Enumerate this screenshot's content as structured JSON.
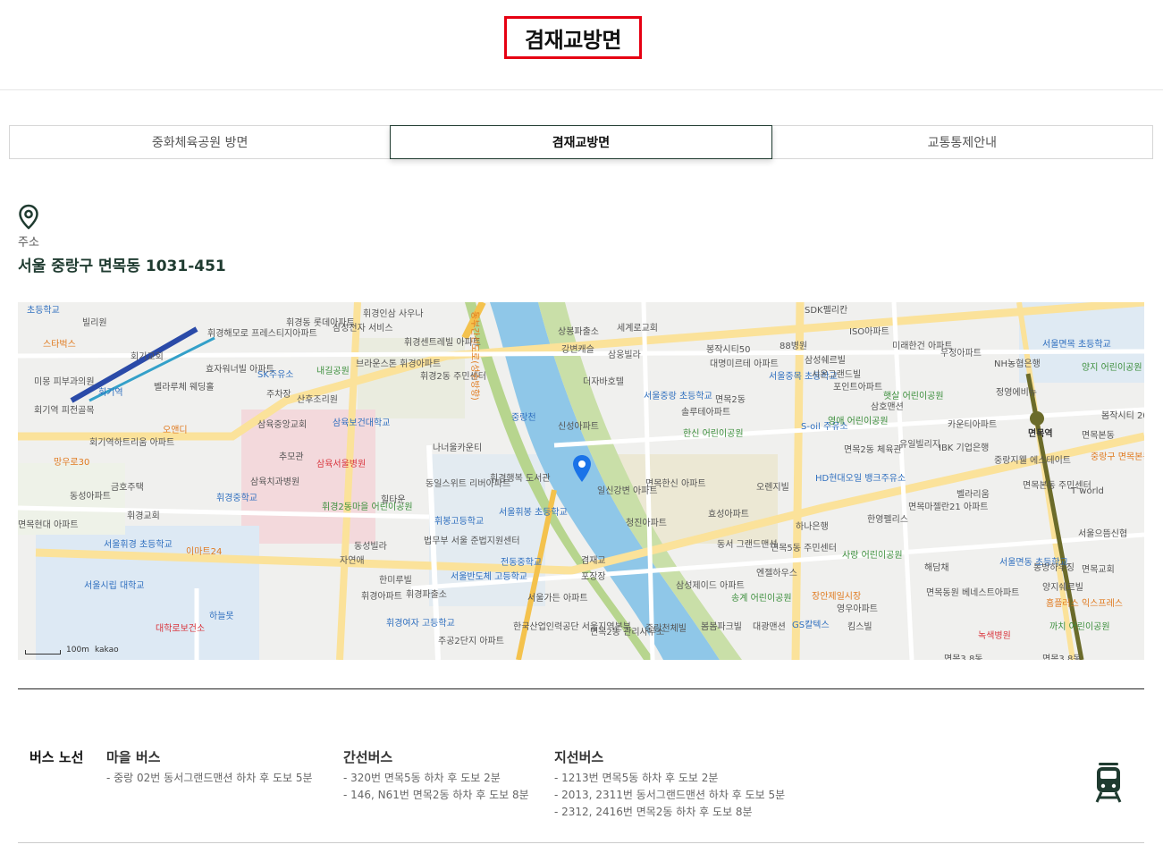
{
  "page": {
    "title": "겸재교방면"
  },
  "tabs": [
    {
      "label": "중화체육공원 방면",
      "active": false
    },
    {
      "label": "겸재교방면",
      "active": true
    },
    {
      "label": "교통통제안내",
      "active": false
    }
  ],
  "address": {
    "icon": "map-pin-icon",
    "label": "주소",
    "value": "서울 중랑구 면목동 1031-451"
  },
  "map": {
    "scale_label": "100m",
    "brand": "kakao",
    "labels": {
      "l1": "초등학교",
      "l2": "빌리원",
      "l3": "스타벅스",
      "l4": "회기역",
      "l5": "회기교회",
      "l6": "휘경해모로 프레스티지아파트",
      "l7": "휘경동 롯데아파트",
      "l8": "삼성전자 서비스",
      "l9": "휘경센트레빌 아파트",
      "l10": "휘경2동 주민센터",
      "l11": "SK주유소",
      "l12": "내길공원",
      "l13": "브라운스톤 휘경아파트",
      "l14": "산후조리원",
      "l15": "삼육중앙교회",
      "l16": "삼육보건대학교",
      "l17": "삼육서울병원",
      "l18": "나너울카운티",
      "l19": "동일스위트 리버아파트",
      "l20": "휘경행복 도서관",
      "l21": "휘봉고등학교",
      "l22": "서울휘봉 초등학교",
      "l23": "휘경2동마을 어린이공원",
      "l24": "법무부 서울 준법지원센터",
      "l25": "전동중학교",
      "l26": "서울반도체 고등학교",
      "l27": "휘경여자 고등학교",
      "l28": "주공2단지 아파트",
      "l29": "서울가든 아파트",
      "l30": "한국산업인력공단 서울지역본부",
      "l31": "상봉파출소",
      "l32": "세계로교회",
      "l33": "강변캐슬",
      "l34": "삼웅빌라",
      "l35": "더자바호텔",
      "l36": "신성아파트",
      "l37": "일신강변 아파트",
      "l38": "면목한신 아파트",
      "l39": "청진아파트",
      "l40": "한신 어린이공원",
      "l41": "서울중랑 초등학교",
      "l42": "솔루테아파트",
      "l43": "봉작시티50",
      "l44": "대명미르테 아파트",
      "l45": "서울중목 초등학교",
      "l46": "면목2동",
      "l47": "88병원",
      "l48": "삼성쉐르빌",
      "l49": "시온그랜드빌",
      "l50": "포인트아파트",
      "l51": "S-oil 주유소",
      "l52": "영애 어린이공원",
      "l53": "면목2동 체육관",
      "l54": "HD현대오일 뱅크주유소",
      "l55": "오렌지빌",
      "l56": "효성아파트",
      "l57": "하나은행",
      "l58": "동서 그랜드맨션",
      "l59": "면목5동 주민센터",
      "l60": "엔젤하우스",
      "l61": "삼성제이드 아파트",
      "l62": "송계 어린이공원",
      "l63": "장안제일시장",
      "l64": "GS칼텍스",
      "l65": "SDK펠리칸",
      "l66": "ISO아파트",
      "l67": "미래한건 아파트",
      "l68": "우정아파트",
      "l69": "NH농협은행",
      "l70": "서울면목 초등학교",
      "l71": "양지 어린이공원",
      "l72": "정영에비뉴",
      "l73": "면목역",
      "l74": "봄작시티 201",
      "l75": "면목본동",
      "l76": "IBK 기업은행",
      "l77": "중랑지웰 에스테이트",
      "l78": "면목본동 주민센터",
      "l79": "T world",
      "l80": "면목마젤란21 아파트",
      "l81": "벨라리움",
      "l82": "서울으뜸신협",
      "l83": "서울면동 초등학교",
      "l84": "동방하우징",
      "l85": "면목교회",
      "l86": "양지쉐르빌",
      "l87": "홈플러스 익스프레스",
      "l88": "녹색병원",
      "l89": "까치 어린이공원",
      "l90": "면목3.8동",
      "l91": "면목동원 베네스트아파트",
      "l92": "사랑 어린이공원",
      "l93": "한영펠리스",
      "l94": "해담채",
      "l95": "영우아파트",
      "l96": "킴스빌",
      "l97": "대광맨션",
      "l98": "봄봄파크빌",
      "l99": "중랑천체빌",
      "l100": "이마트24",
      "l101": "서울휘경 초등학교",
      "l102": "서울시립 대학교",
      "l103": "대학로보건소",
      "l104": "하늘못",
      "l105": "중랑천",
      "l106": "겸재교",
      "l107": "포장장",
      "l108": "휘경교회",
      "l109": "동성빌라",
      "l110": "자연애",
      "l111": "한미루빌",
      "l112": "휘경아파트",
      "l113": "휘경파출소",
      "l114": "힐타운",
      "l115": "삼육치과병원",
      "l116": "휘경중학교",
      "l117": "금호주택",
      "l118": "동성아파트",
      "l119": "오앤디",
      "l120": "망우로30",
      "l121": "회기역하트리움 아파트",
      "l122": "벨라루체 웨딩홀",
      "l123": "효자워너빌 아파트",
      "l124": "미몽 피부과의원",
      "l125": "회기역 피전골목",
      "l126": "추모관",
      "l127": "주차장",
      "l128": "동부간선도로(성수방향)",
      "l129": "유일빌리지",
      "l130": "면목2동 관리사무소",
      "l131": "면목현대 아파트",
      "l132": "카운티아파트",
      "l133": "중랑구 면목본동 공공지원민간",
      "l134": "휘경인삼 사우나",
      "l135": "삼호맨션",
      "l136": "면목3.8동",
      "l137": "햇살 어린이공원"
    }
  },
  "bus": {
    "title": "버스 노선",
    "groups": [
      {
        "name": "마을 버스",
        "items": [
          "- 중랑 02번 동서그랜드맨션 하차 후 도보 5분"
        ]
      },
      {
        "name": "간선버스",
        "items": [
          "- 320번 면목5동 하차 후 도보 2분",
          "- 146, N61번 면목2동 하차 후 도보 8분"
        ]
      },
      {
        "name": "지선버스",
        "items": [
          "- 1213번 면목5동 하차 후 도보 2분",
          "- 2013, 2311번 동서그랜드맨션 하차 후 도보 5분",
          "- 2312, 2416번 면목2동 하차 후 도보 8분"
        ]
      }
    ],
    "icon": "train-icon"
  },
  "colors": {
    "accent": "#1f3b30",
    "highlight_border": "#e60012",
    "river": "#8fc7e8",
    "road": "#fbe29a"
  }
}
